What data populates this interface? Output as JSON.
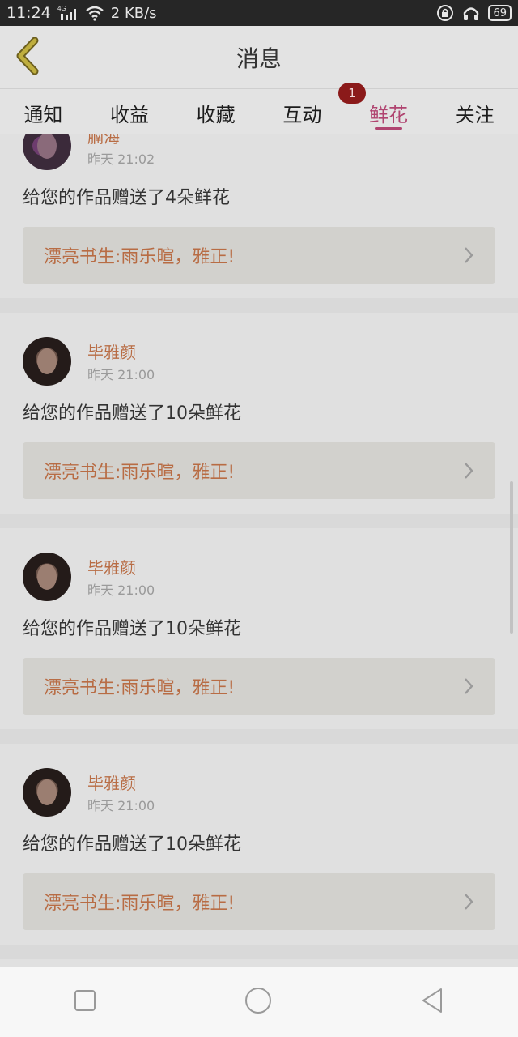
{
  "status_bar": {
    "time": "11:24",
    "network": "4G",
    "speed": "2 KB/s",
    "battery": "69",
    "icons": [
      "signal-icon",
      "wifi-icon",
      "lock-rotation-icon",
      "headphones-icon",
      "battery-icon"
    ]
  },
  "header": {
    "title": "消息",
    "back_icon": "back-chevron-icon"
  },
  "tabs": [
    {
      "label": "通知"
    },
    {
      "label": "收益"
    },
    {
      "label": "收藏"
    },
    {
      "label": "互动",
      "badge": "1"
    },
    {
      "label": "鲜花",
      "active": true
    },
    {
      "label": "关注"
    }
  ],
  "feed": {
    "items": [
      {
        "name": "腩海",
        "time": "昨天 21:02",
        "message": "给您的作品赠送了4朵鲜花",
        "work": "漂亮书生:雨乐暄，雅正!"
      },
      {
        "name": "毕雅颜",
        "time": "昨天 21:00",
        "message": "给您的作品赠送了10朵鲜花",
        "work": "漂亮书生:雨乐暄，雅正!"
      },
      {
        "name": "毕雅颜",
        "time": "昨天 21:00",
        "message": "给您的作品赠送了10朵鲜花",
        "work": "漂亮书生:雨乐暄，雅正!"
      },
      {
        "name": "毕雅颜",
        "time": "昨天 21:00",
        "message": "给您的作品赠送了10朵鲜花",
        "work": "漂亮书生:雨乐暄，雅正!"
      }
    ]
  },
  "colors": {
    "accent": "#b04470",
    "name": "#b86c44",
    "badge": "#8b1a1a"
  },
  "nav_bar": {
    "icons": [
      "recents-icon",
      "home-icon",
      "back-icon"
    ]
  }
}
